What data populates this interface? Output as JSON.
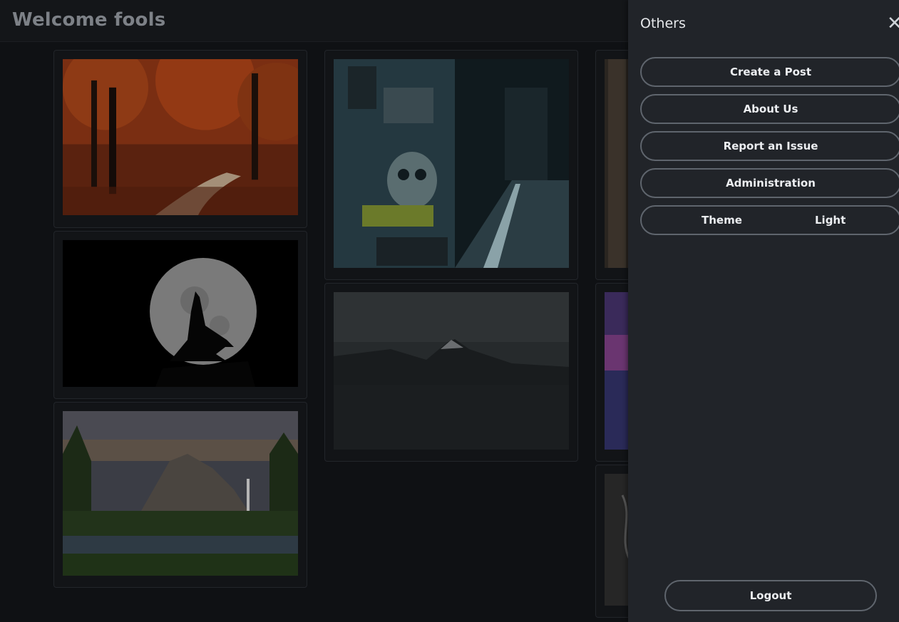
{
  "header": {
    "title": "Welcome fools"
  },
  "panel": {
    "title": "Others",
    "close_glyph": "✕",
    "menu": [
      {
        "label": "Create a Post"
      },
      {
        "label": "About Us"
      },
      {
        "label": "Report an Issue"
      },
      {
        "label": "Administration"
      }
    ],
    "theme": {
      "label": "Theme",
      "value": "Light"
    },
    "logout_label": "Logout"
  },
  "gallery": {
    "images": [
      {
        "name": "autumn-forest-path",
        "colors": [
          "#6b2a12",
          "#a8461d",
          "#3a2416"
        ]
      },
      {
        "name": "wolf-howling-moon",
        "colors": [
          "#000000",
          "#8a8a8a",
          "#0b0b0b"
        ]
      },
      {
        "name": "mountain-waterfall-valley",
        "colors": [
          "#3c3f48",
          "#5a5044",
          "#223319"
        ]
      },
      {
        "name": "graffiti-alley-night",
        "colors": [
          "#18272d",
          "#3b5159",
          "#0e1417"
        ]
      },
      {
        "name": "mount-fuji-lake",
        "colors": [
          "#2b2e30",
          "#1c1f21",
          "#121416"
        ]
      },
      {
        "name": "tree-bark",
        "colors": [
          "#2a2520",
          "#3b342d",
          "#1b1815"
        ]
      },
      {
        "name": "purple-city-dusk",
        "colors": [
          "#3a2a5a",
          "#6a3570",
          "#2a2a58"
        ]
      },
      {
        "name": "sketch-drawing",
        "colors": [
          "#2a2a2a",
          "#444444",
          "#1c1c1c"
        ]
      }
    ]
  }
}
